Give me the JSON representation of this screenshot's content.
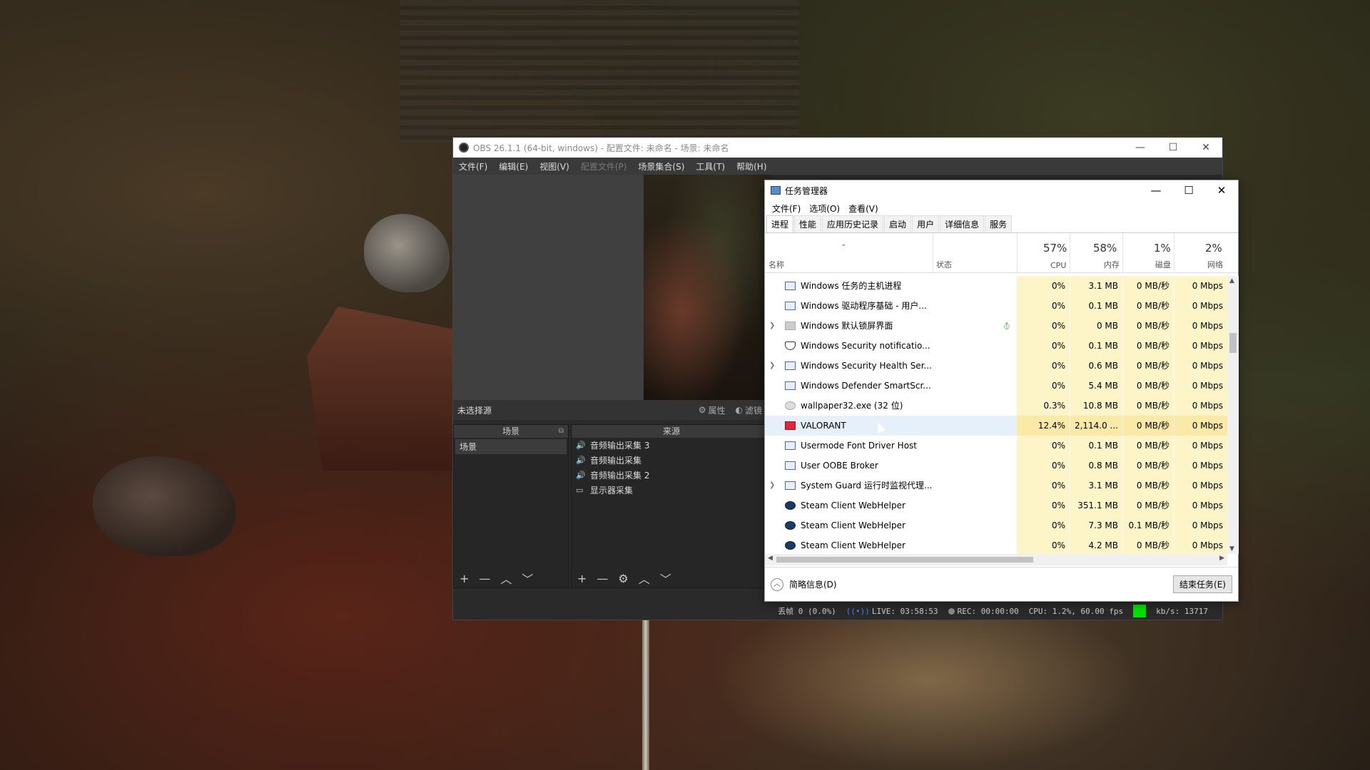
{
  "obs": {
    "title": "OBS 26.1.1 (64-bit, windows) - 配置文件: 未命名 - 场景: 未命名",
    "menu": [
      "文件(F)",
      "编辑(E)",
      "视图(V)",
      "配置文件(P)",
      "场景集合(S)",
      "工具(T)",
      "帮助(H)"
    ],
    "no_source": "未选择源",
    "properties": "属性",
    "filters": "滤镜",
    "scenes_title": "场景",
    "sources_title": "来源",
    "scenes": [
      "场景"
    ],
    "sources": [
      {
        "icon": "speaker-icon",
        "label": "音频输出采集 3"
      },
      {
        "icon": "speaker-icon",
        "label": "音频输出采集"
      },
      {
        "icon": "speaker-icon",
        "label": "音频输出采集 2"
      },
      {
        "icon": "monitor-icon",
        "label": "显示器采集"
      }
    ],
    "status": {
      "dropped": "丢帧 0 (0.0%)",
      "live": "LIVE: 03:58:53",
      "rec": "REC: 00:00:00",
      "cpu": "CPU: 1.2%, 60.00 fps",
      "bitrate": "kb/s: 13717"
    }
  },
  "taskmanager": {
    "title": "任务管理器",
    "menu": [
      "文件(F)",
      "选项(O)",
      "查看(V)"
    ],
    "tabs": [
      "进程",
      "性能",
      "应用历史记录",
      "启动",
      "用户",
      "详细信息",
      "服务"
    ],
    "active_tab": "进程",
    "headers": {
      "name": "名称",
      "status": "状态",
      "cpu_pct": "57%",
      "cpu": "CPU",
      "mem_pct": "58%",
      "mem": "内存",
      "disk_pct": "1%",
      "disk": "磁盘",
      "net_pct": "2%",
      "net": "网络"
    },
    "rows": [
      {
        "name": "Windows 任务的主机进程",
        "icon": "window-icon",
        "expand": false,
        "cpu": "0%",
        "mem": "3.1 MB",
        "disk": "0 MB/秒",
        "net": "0 Mbps"
      },
      {
        "name": "Windows 驱动程序基础 - 用户...",
        "icon": "window-icon",
        "expand": false,
        "cpu": "0%",
        "mem": "0.1 MB",
        "disk": "0 MB/秒",
        "net": "0 Mbps"
      },
      {
        "name": "Windows 默认锁屏界面",
        "icon": "blank-icon",
        "expand": true,
        "leaf": true,
        "cpu": "0%",
        "mem": "0 MB",
        "disk": "0 MB/秒",
        "net": "0 Mbps"
      },
      {
        "name": "Windows Security notificatio...",
        "icon": "shield-icon",
        "expand": false,
        "cpu": "0%",
        "mem": "0.1 MB",
        "disk": "0 MB/秒",
        "net": "0 Mbps"
      },
      {
        "name": "Windows Security Health Ser...",
        "icon": "window-icon",
        "expand": true,
        "cpu": "0%",
        "mem": "0.6 MB",
        "disk": "0 MB/秒",
        "net": "0 Mbps"
      },
      {
        "name": "Windows Defender SmartScr...",
        "icon": "window-icon",
        "expand": false,
        "cpu": "0%",
        "mem": "5.4 MB",
        "disk": "0 MB/秒",
        "net": "0 Mbps"
      },
      {
        "name": "wallpaper32.exe (32 位)",
        "icon": "wallpaper-icon",
        "expand": false,
        "cpu": "0.3%",
        "mem": "10.8 MB",
        "disk": "0 MB/秒",
        "net": "0 Mbps"
      },
      {
        "name": "VALORANT",
        "icon": "valorant-icon",
        "expand": false,
        "selected": true,
        "cpu": "12.4%",
        "mem": "2,114.0 ...",
        "disk": "0 MB/秒",
        "net": "0 Mbps"
      },
      {
        "name": "Usermode Font Driver Host",
        "icon": "window-icon",
        "expand": false,
        "cpu": "0%",
        "mem": "0.1 MB",
        "disk": "0 MB/秒",
        "net": "0 Mbps"
      },
      {
        "name": "User OOBE Broker",
        "icon": "window-icon",
        "expand": false,
        "cpu": "0%",
        "mem": "0.8 MB",
        "disk": "0 MB/秒",
        "net": "0 Mbps"
      },
      {
        "name": "System Guard 运行时监视代理...",
        "icon": "window-icon",
        "expand": true,
        "cpu": "0%",
        "mem": "3.1 MB",
        "disk": "0 MB/秒",
        "net": "0 Mbps"
      },
      {
        "name": "Steam Client WebHelper",
        "icon": "steam-icon",
        "expand": false,
        "cpu": "0%",
        "mem": "351.1 MB",
        "disk": "0 MB/秒",
        "net": "0 Mbps"
      },
      {
        "name": "Steam Client WebHelper",
        "icon": "steam-icon",
        "expand": false,
        "cpu": "0%",
        "mem": "7.3 MB",
        "disk": "0.1 MB/秒",
        "net": "0 Mbps"
      },
      {
        "name": "Steam Client WebHelper",
        "icon": "steam-icon",
        "expand": false,
        "cpu": "0%",
        "mem": "4.2 MB",
        "disk": "0 MB/秒",
        "net": "0 Mbps"
      }
    ],
    "fewer_details": "简略信息(D)",
    "end_task": "结束任务(E)"
  }
}
